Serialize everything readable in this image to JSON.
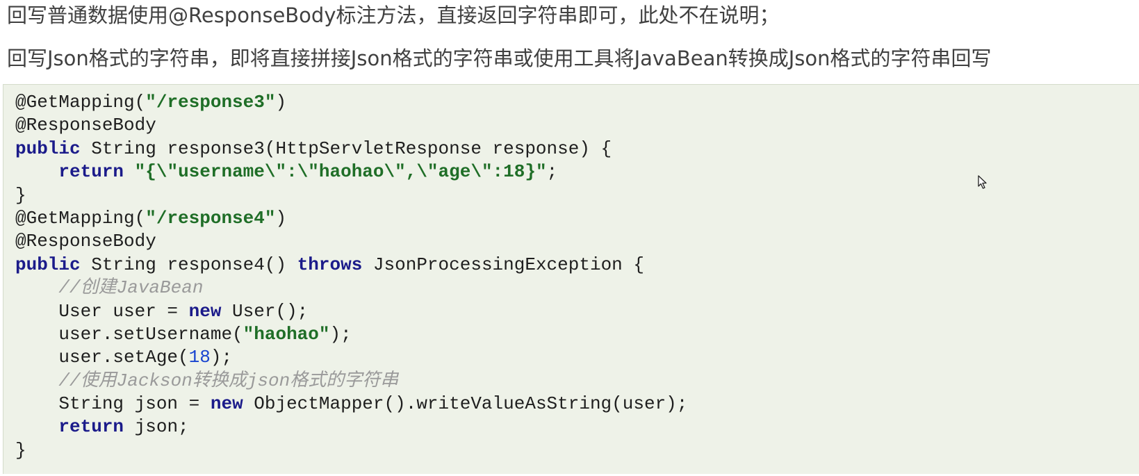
{
  "intro": {
    "line1": "回写普通数据使用@ResponseBody标注方法，直接返回字符串即可，此处不在说明；",
    "line2": "回写Json格式的字符串，即将直接拼接Json格式的字符串或使用工具将JavaBean转换成Json格式的字符串回写"
  },
  "code": {
    "lines": [
      [
        {
          "t": "plain",
          "v": "@GetMapping("
        },
        {
          "t": "str",
          "v": "\"/response3\""
        },
        {
          "t": "plain",
          "v": ")"
        }
      ],
      [
        {
          "t": "plain",
          "v": "@ResponseBody"
        }
      ],
      [
        {
          "t": "kw",
          "v": "public"
        },
        {
          "t": "plain",
          "v": " String response3(HttpServletResponse response) {"
        }
      ],
      [
        {
          "t": "plain",
          "v": "    "
        },
        {
          "t": "kw",
          "v": "return"
        },
        {
          "t": "plain",
          "v": " "
        },
        {
          "t": "str",
          "v": "\"{\\\"username\\\":\\\"haohao\\\",\\\"age\\\":18}\""
        },
        {
          "t": "plain",
          "v": ";"
        }
      ],
      [
        {
          "t": "plain",
          "v": "}"
        }
      ],
      [
        {
          "t": "plain",
          "v": "@GetMapping("
        },
        {
          "t": "str",
          "v": "\"/response4\""
        },
        {
          "t": "plain",
          "v": ")"
        }
      ],
      [
        {
          "t": "plain",
          "v": "@ResponseBody"
        }
      ],
      [
        {
          "t": "kw",
          "v": "public"
        },
        {
          "t": "plain",
          "v": " String response4() "
        },
        {
          "t": "kw",
          "v": "throws"
        },
        {
          "t": "plain",
          "v": " JsonProcessingException {"
        }
      ],
      [
        {
          "t": "plain",
          "v": "    "
        },
        {
          "t": "cmt",
          "v": "//创建JavaBean"
        }
      ],
      [
        {
          "t": "plain",
          "v": "    User user = "
        },
        {
          "t": "kw",
          "v": "new"
        },
        {
          "t": "plain",
          "v": " User();"
        }
      ],
      [
        {
          "t": "plain",
          "v": "    user.setUsername("
        },
        {
          "t": "str",
          "v": "\"haohao\""
        },
        {
          "t": "plain",
          "v": ");"
        }
      ],
      [
        {
          "t": "plain",
          "v": "    user.setAge("
        },
        {
          "t": "num",
          "v": "18"
        },
        {
          "t": "plain",
          "v": ");"
        }
      ],
      [
        {
          "t": "plain",
          "v": "    "
        },
        {
          "t": "cmt",
          "v": "//使用Jackson转换成json格式的字符串"
        }
      ],
      [
        {
          "t": "plain",
          "v": "    String json = "
        },
        {
          "t": "kw",
          "v": "new"
        },
        {
          "t": "plain",
          "v": " ObjectMapper().writeValueAsString(user);"
        }
      ],
      [
        {
          "t": "plain",
          "v": "    "
        },
        {
          "t": "kw",
          "v": "return"
        },
        {
          "t": "plain",
          "v": " json;"
        }
      ],
      [
        {
          "t": "plain",
          "v": "}"
        }
      ]
    ]
  },
  "colors": {
    "page_background": "#ffffff",
    "intro_text": "#404040",
    "code_background": "#eef2e8",
    "keyword": "#1b1b8a",
    "string": "#1f6e27",
    "number": "#1a45d0",
    "comment": "#9a9a9a"
  },
  "icons": {
    "cursor": "mouse-pointer-icon"
  }
}
